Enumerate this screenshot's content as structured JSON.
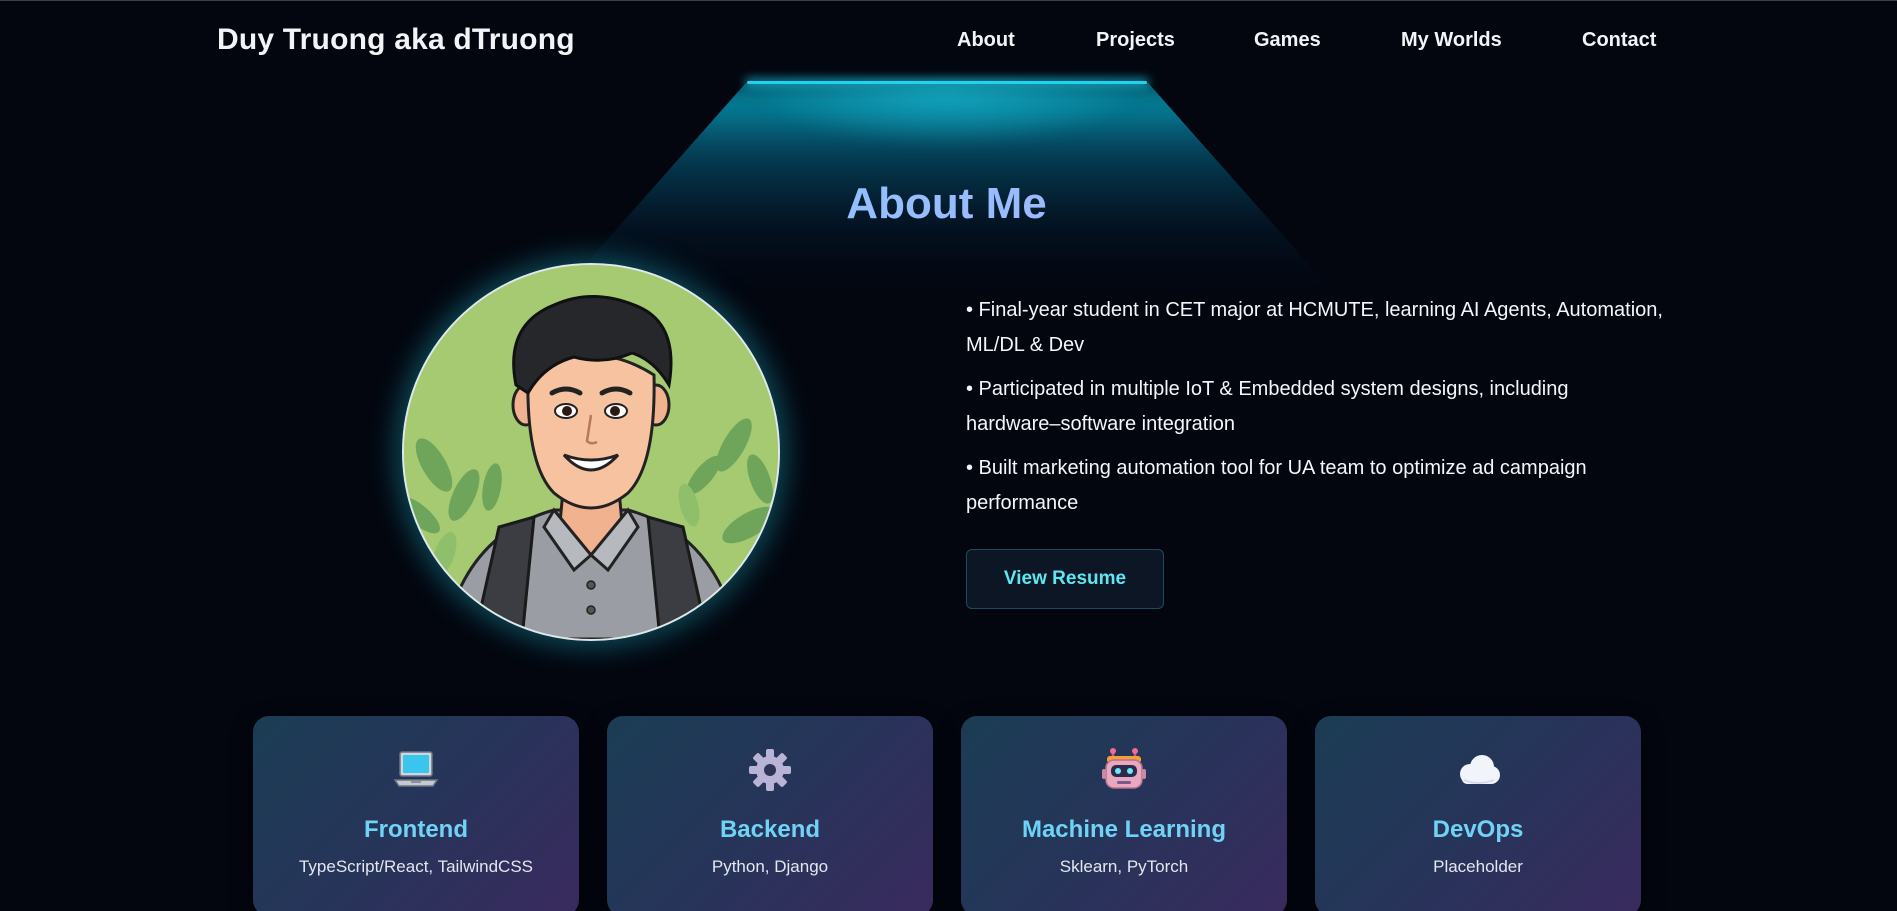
{
  "header": {
    "brand": "Duy Truong aka dTruong",
    "nav": [
      {
        "label": "About",
        "icon": ""
      },
      {
        "label": "Projects",
        "icon": ""
      },
      {
        "label": "Games",
        "icon": ""
      },
      {
        "label": "My Worlds",
        "icon": ""
      },
      {
        "label": "Contact",
        "icon": ""
      }
    ]
  },
  "about": {
    "title": "About Me",
    "bullets": [
      "• Final-year student in CET major at HCMUTE, learning AI Agents, Automation, ML/DL & Dev",
      "• Participated in multiple IoT & Embedded system designs, including hardware–software integration",
      "• Built marketing automation tool for UA team to optimize ad campaign performance"
    ],
    "resume_button": "View Resume",
    "avatar_icon": "cartoon-avatar"
  },
  "skills": [
    {
      "icon": "laptop-icon",
      "title": "Frontend",
      "desc": "TypeScript/React, TailwindCSS"
    },
    {
      "icon": "gear-icon",
      "title": "Backend",
      "desc": "Python, Django"
    },
    {
      "icon": "robot-icon",
      "title": "Machine Learning",
      "desc": "Sklearn, PyTorch"
    },
    {
      "icon": "cloud-icon",
      "title": "DevOps",
      "desc": "Placeholder"
    }
  ],
  "colors": {
    "background": "#03060f",
    "accent_cyan": "#22d3ee",
    "title_gradient_start": "#6fd3f6",
    "title_gradient_end": "#c4b5fd",
    "button_text": "#5ee7f3",
    "card_gradient_start": "#1b3d54",
    "card_gradient_end": "#3a2a5e"
  }
}
